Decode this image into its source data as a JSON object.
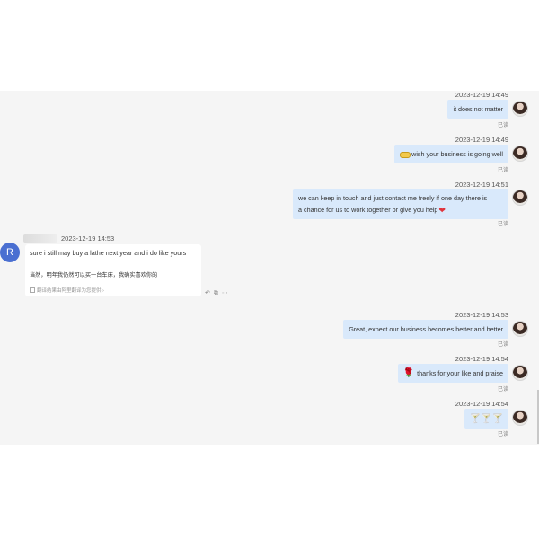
{
  "messages_out": [
    {
      "time": "2023-12-19 14:49",
      "text": "it does not matter",
      "status": "已读"
    },
    {
      "time": "2023-12-19 14:49",
      "text": "wish your business is going well",
      "status": "已读",
      "emoji": "money-bag-icon"
    },
    {
      "time": "2023-12-19 14:51",
      "text_line1": "we can keep in touch and just contact me freely if one day there is",
      "text_line2": "a chance for us to work together or give you help",
      "status": "已读",
      "emoji": "heart-icon"
    },
    {
      "time": "2023-12-19 14:53",
      "text": "Great, expect our business becomes better and better",
      "status": "已读"
    },
    {
      "time": "2023-12-19 14:54",
      "text": "thanks for your like and praise",
      "status": "已读",
      "emoji": "rose-icon"
    },
    {
      "time": "2023-12-19 14:54",
      "glyphs": "🍸🍸🍸",
      "status": "已读",
      "emoji": "cocktail-icon"
    }
  ],
  "message_in": {
    "avatar_letter": "R",
    "time": "2023-12-19 14:53",
    "text": "sure i still may buy a lathe next year and i do like yours",
    "translation": "当然，明年我仍然可以买一台车床，我确实喜欢你的",
    "note": "翻译结果由阿里翻译为您提供 ›",
    "tools": [
      "reply-icon",
      "quote-icon",
      "more-icon"
    ]
  },
  "colors": {
    "bubble_out": "#d9e9fb",
    "chat_bg": "#f5f5f5",
    "avatar_left": "#4a6fd1"
  }
}
